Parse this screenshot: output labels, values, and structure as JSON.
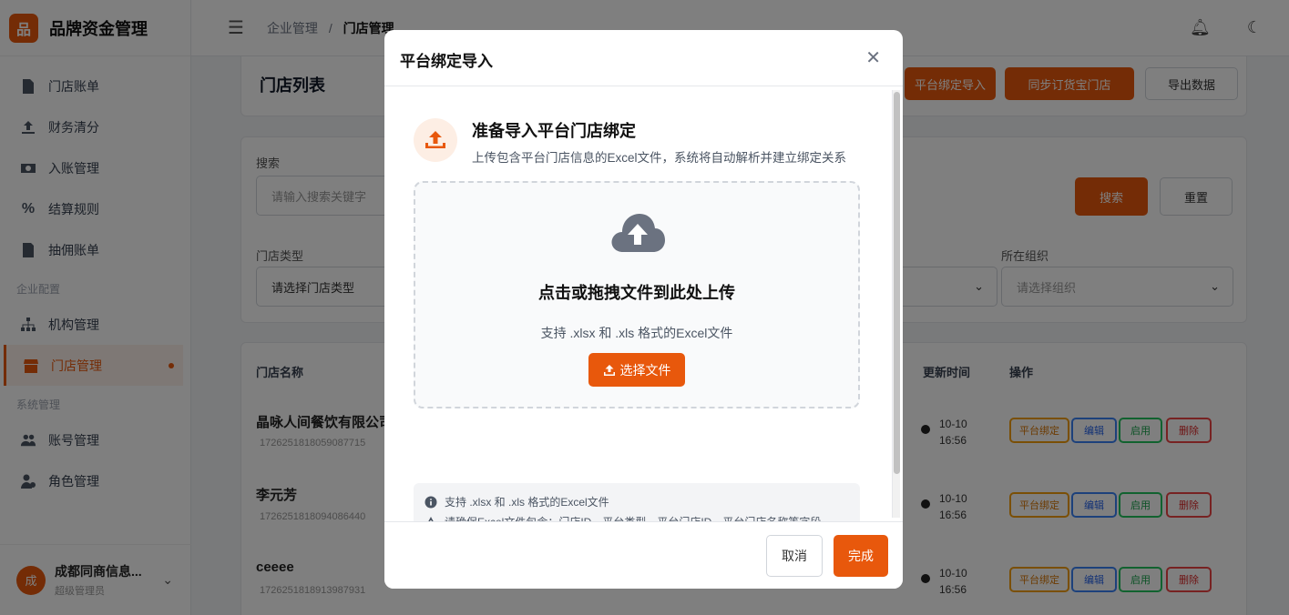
{
  "app": {
    "brand": "品牌资金管理",
    "brand_logo": "品"
  },
  "sidebar": {
    "items": [
      {
        "label": "门店账单",
        "icon": "document-icon"
      },
      {
        "label": "财务清分",
        "icon": "upload-icon"
      },
      {
        "label": "入账管理",
        "icon": "money-icon"
      },
      {
        "label": "结算规则",
        "icon": "percent-icon"
      },
      {
        "label": "抽佣账单",
        "icon": "bill-icon"
      }
    ],
    "group_company": "企业配置",
    "company_items": [
      {
        "label": "机构管理",
        "icon": "org-icon"
      },
      {
        "label": "门店管理",
        "icon": "store-icon",
        "active": true
      }
    ],
    "group_system": "系统管理",
    "system_items": [
      {
        "label": "账号管理",
        "icon": "users-icon"
      },
      {
        "label": "角色管理",
        "icon": "role-icon"
      }
    ],
    "user": {
      "avatar": "成",
      "name": "成都同商信息...",
      "role": "超级管理员"
    }
  },
  "topbar": {
    "crumb_parent": "企业管理",
    "crumb_sep": "/",
    "crumb_current": "门店管理"
  },
  "list": {
    "title": "门店列表",
    "btn_platform_import": "平台绑定导入",
    "btn_sync": "同步订货宝门店",
    "btn_export": "导出数据",
    "search_label": "搜索",
    "search_placeholder": "请输入搜索关键字",
    "btn_search": "搜索",
    "btn_reset": "重置",
    "type_label": "门店类型",
    "type_placeholder": "请选择门店类型",
    "org_label": "所在组织",
    "org_placeholder": "请选择组织",
    "col_name": "门店名称",
    "col_updated": "更新时间",
    "col_action": "操作",
    "rows": [
      {
        "name": "晶咏人间餐饮有限公司",
        "id": "1726251818059087715",
        "time1": "10-10",
        "time2": "16:56"
      },
      {
        "name": "李元芳",
        "id": "1726251818094086440",
        "time1": "10-10",
        "time2": "16:56"
      },
      {
        "name": "ceeee",
        "id": "1726251818913987931",
        "time1": "10-10",
        "time2": "16:56"
      }
    ],
    "actions": [
      "平台绑定",
      "编辑",
      "启用",
      "删除"
    ]
  },
  "modal": {
    "title": "平台绑定导入",
    "hero_title": "准备导入平台门店绑定",
    "hero_desc": "上传包含平台门店信息的Excel文件，系统将自动解析并建立绑定关系",
    "dropzone_title": "点击或拖拽文件到此处上传",
    "dropzone_hint": "支持 .xlsx 和 .xls 格式的Excel文件",
    "choose_button": "选择文件",
    "note1": "支持 .xlsx 和 .xls 格式的Excel文件",
    "note2": "请确保Excel文件包含：门店ID、平台类型、平台门店ID、平台门店名称等字段",
    "cancel": "取消",
    "done": "完成"
  },
  "colors": {
    "accent": "#e8580c"
  }
}
